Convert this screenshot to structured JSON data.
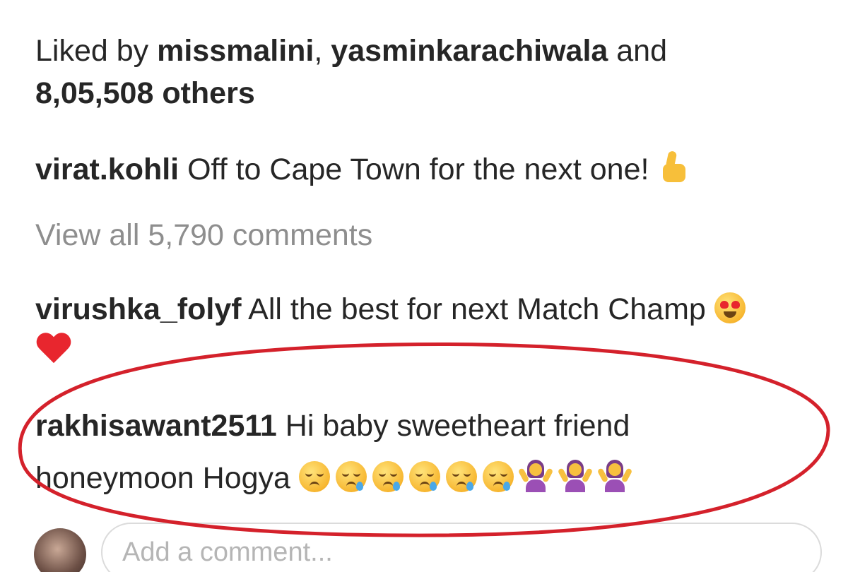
{
  "likes": {
    "prefix": "Liked by ",
    "user1": "missmalini",
    "separator": ", ",
    "user2": "yasminkarachiwala",
    "conjunction": " and",
    "others": "8,05,508 others"
  },
  "caption": {
    "username": "virat.kohli",
    "text": " Off to Cape Town for the next one! ",
    "emoji": "thumbs-up"
  },
  "view_comments": "View all 5,790 comments",
  "comments": [
    {
      "username": "virushka_folyf",
      "text": " All the best for next Match Champ ",
      "emojis": [
        "heart-eyes",
        "red-heart"
      ]
    },
    {
      "username": "rakhisawant2511",
      "text_line1": " Hi baby sweetheart friend",
      "text_line2": "honeymoon Hogya ",
      "emojis": [
        "pensive-face",
        "sleepy-face",
        "sleepy-face",
        "sleepy-face",
        "sleepy-face",
        "sleepy-face",
        "woman-shrugging",
        "woman-shrugging",
        "woman-shrugging"
      ]
    }
  ],
  "comment_box": {
    "placeholder": "Add a comment..."
  },
  "colors": {
    "highlight": "#d4212b",
    "text": "#262626",
    "muted": "#8e8e8e"
  }
}
